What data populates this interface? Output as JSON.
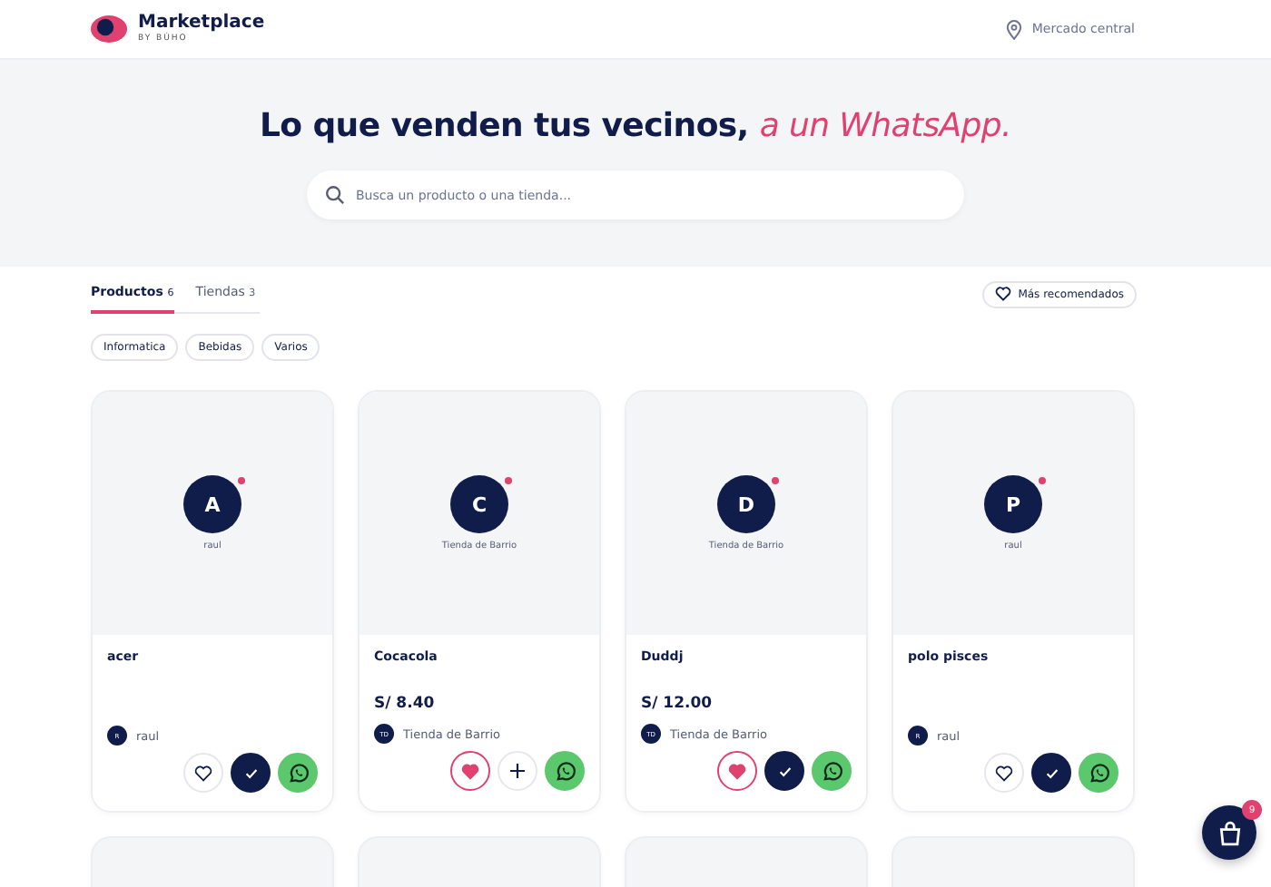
{
  "header": {
    "brand": "Marketplace",
    "brand_sub": "BY BÚHO",
    "location": "Mercado central"
  },
  "hero": {
    "title": "Lo que venden tus vecinos,",
    "title_accent": "a un WhatsApp.",
    "search": {
      "placeholder": "Busca un producto o una tienda..."
    }
  },
  "tabs": [
    {
      "label": "Productos",
      "count": "6",
      "selected": true
    },
    {
      "label": "Tiendas",
      "count": "3",
      "selected": false
    }
  ],
  "sort_button": "Más recomendados",
  "filters": [
    "Informatica",
    "Bebidas",
    "Varios"
  ],
  "products": [
    {
      "initial": "A",
      "store": "raul",
      "name": "acer",
      "seller_initials": "R",
      "seller": "raul",
      "favorite": false,
      "in_cart": true
    },
    {
      "initial": "C",
      "store": "Tienda de Barrio",
      "name": "Cocacola",
      "price": "S/ 8.40",
      "seller_initials": "TD",
      "seller": "Tienda de Barrio",
      "favorite": true,
      "in_cart": false
    },
    {
      "initial": "D",
      "store": "Tienda de Barrio",
      "name": "Duddj",
      "price": "S/ 12.00",
      "seller_initials": "TD",
      "seller": "Tienda de Barrio",
      "favorite": true,
      "in_cart": true
    },
    {
      "initial": "P",
      "store": "raul",
      "name": "polo pisces",
      "seller_initials": "R",
      "seller": "raul",
      "favorite": false,
      "in_cart": true
    }
  ],
  "more_products": [
    {
      "kind": "card"
    },
    {
      "kind": "card"
    },
    {
      "kind": "card"
    },
    {
      "kind": "card"
    }
  ],
  "cart": {
    "count": "9"
  }
}
